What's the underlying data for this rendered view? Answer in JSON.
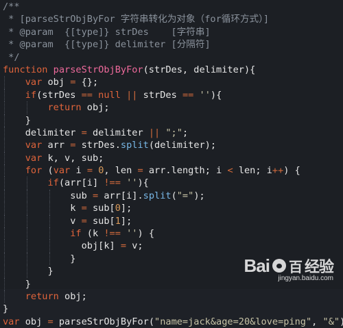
{
  "code_lines": [
    [
      [
        "cm",
        "/**"
      ]
    ],
    [
      [
        "cm",
        " * [parseStrObjByFor 字符串转化为对象（for循环方式）]"
      ]
    ],
    [
      [
        "cm",
        " * @param  {[type]} strDes    [字符串]"
      ]
    ],
    [
      [
        "cm",
        " * @param  {[type]} delimiter [分隔符]"
      ]
    ],
    [
      [
        "cm",
        " */"
      ]
    ],
    [
      [
        "kw",
        "function "
      ],
      [
        "fn",
        "parseStrObjByFor"
      ],
      [
        "pun",
        "(strDes, delimiter){"
      ]
    ],
    [
      [
        "pun",
        "    "
      ],
      [
        "kw",
        "var "
      ],
      [
        "id",
        "obj "
      ],
      [
        "op",
        "= "
      ],
      [
        "pun",
        "{};"
      ]
    ],
    [
      [
        "pun",
        "    "
      ],
      [
        "kw",
        "if"
      ],
      [
        "pun",
        "(strDes "
      ],
      [
        "op",
        "== "
      ],
      [
        "kw",
        "null "
      ],
      [
        "op",
        "|| "
      ],
      [
        "id",
        "strDes "
      ],
      [
        "op",
        "== "
      ],
      [
        "str",
        "''"
      ],
      [
        "pun",
        "){"
      ]
    ],
    [
      [
        "pun",
        "        "
      ],
      [
        "kw",
        "return "
      ],
      [
        "id",
        "obj;"
      ]
    ],
    [
      [
        "pun",
        "    }"
      ]
    ],
    [
      [
        "pun",
        "    "
      ],
      [
        "id",
        "delimiter "
      ],
      [
        "op",
        "= "
      ],
      [
        "id",
        "delimiter "
      ],
      [
        "op",
        "|| "
      ],
      [
        "str",
        "\";\""
      ],
      [
        "pun",
        ";"
      ]
    ],
    [
      [
        "pun",
        "    "
      ],
      [
        "kw",
        "var "
      ],
      [
        "id",
        "arr "
      ],
      [
        "op",
        "= "
      ],
      [
        "id",
        "strDes."
      ],
      [
        "prop",
        "split"
      ],
      [
        "pun",
        "(delimiter);"
      ]
    ],
    [
      [
        "pun",
        "    "
      ],
      [
        "kw",
        "var "
      ],
      [
        "id",
        "k, v, sub;"
      ]
    ],
    [
      [
        "pun",
        "    "
      ],
      [
        "kw",
        "for "
      ],
      [
        "pun",
        "("
      ],
      [
        "kw",
        "var "
      ],
      [
        "id",
        "i "
      ],
      [
        "op",
        "= "
      ],
      [
        "num",
        "0"
      ],
      [
        "pun",
        ", len "
      ],
      [
        "op",
        "= "
      ],
      [
        "id",
        "arr.length; i "
      ],
      [
        "op",
        "< "
      ],
      [
        "id",
        "len; i"
      ],
      [
        "op",
        "++"
      ],
      [
        "pun",
        ") {"
      ]
    ],
    [
      [
        "pun",
        "        "
      ],
      [
        "kw",
        "if"
      ],
      [
        "pun",
        "(arr[i] "
      ],
      [
        "op",
        "!== "
      ],
      [
        "str",
        "''"
      ],
      [
        "pun",
        "){"
      ]
    ],
    [
      [
        "pun",
        "            "
      ],
      [
        "id",
        "sub "
      ],
      [
        "op",
        "= "
      ],
      [
        "id",
        "arr[i]."
      ],
      [
        "prop",
        "split"
      ],
      [
        "pun",
        "("
      ],
      [
        "str",
        "\"=\""
      ],
      [
        "pun",
        ");"
      ]
    ],
    [
      [
        "pun",
        "            "
      ],
      [
        "id",
        "k "
      ],
      [
        "op",
        "= "
      ],
      [
        "id",
        "sub["
      ],
      [
        "num",
        "0"
      ],
      [
        "pun",
        "];"
      ]
    ],
    [
      [
        "pun",
        "            "
      ],
      [
        "id",
        "v "
      ],
      [
        "op",
        "= "
      ],
      [
        "id",
        "sub["
      ],
      [
        "num",
        "1"
      ],
      [
        "pun",
        "];"
      ]
    ],
    [
      [
        "pun",
        "            "
      ],
      [
        "kw",
        "if "
      ],
      [
        "pun",
        "(k "
      ],
      [
        "op",
        "!== "
      ],
      [
        "str",
        "''"
      ],
      [
        "pun",
        ") {"
      ]
    ],
    [
      [
        "pun",
        "              "
      ],
      [
        "id",
        "obj[k] "
      ],
      [
        "op",
        "= "
      ],
      [
        "id",
        "v;"
      ]
    ],
    [
      [
        "pun",
        "            }"
      ]
    ],
    [
      [
        "pun",
        "        }"
      ]
    ],
    [
      [
        "pun",
        "    }"
      ]
    ],
    [
      [
        "pun",
        "    "
      ],
      [
        "kw",
        "return "
      ],
      [
        "id",
        "obj;"
      ]
    ],
    [
      [
        "pun",
        "}"
      ]
    ],
    [
      [
        "kw",
        "var "
      ],
      [
        "id",
        "obj "
      ],
      [
        "op",
        "= "
      ],
      [
        "id",
        "parseStrObjByFor("
      ],
      [
        "str",
        "\"name=jack&age=20&love=ping\""
      ],
      [
        "pun",
        ", "
      ],
      [
        "str",
        "\"&\""
      ],
      [
        "pun",
        ");"
      ]
    ]
  ],
  "colors": {
    "background": "#1c1f24",
    "comment": "#8a929c",
    "keyword": "#e0643b",
    "function_name": "#ef6a9c",
    "string": "#c7c3a6",
    "number": "#d99a5a"
  },
  "watermark": {
    "brand_left": "Bai",
    "brand_right": "百",
    "brand_suffix": "经验",
    "url": "jingyan.baidu.com"
  }
}
